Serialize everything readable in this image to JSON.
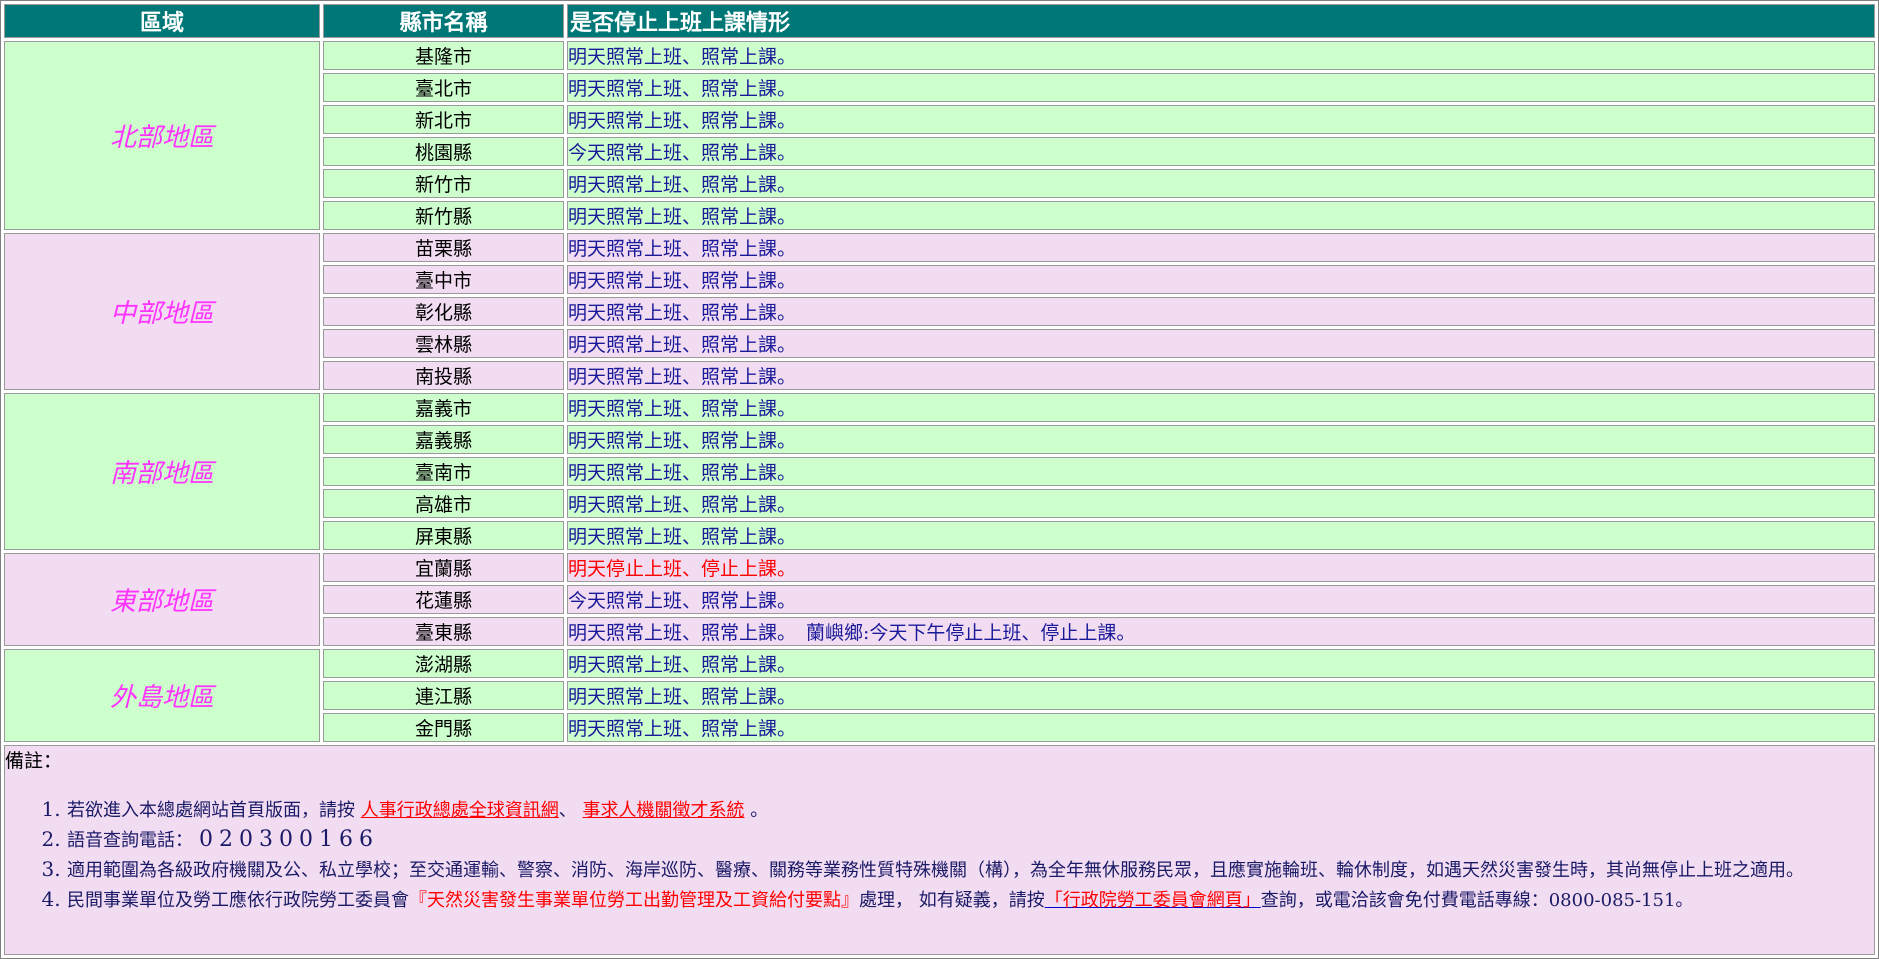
{
  "headers": {
    "region": "區域",
    "county": "縣市名稱",
    "status": "是否停止上班上課情形"
  },
  "colors": {
    "header_bg": "#007777",
    "green_row": "#ccffcc",
    "pink_row": "#f2dcf2",
    "region_text": "#ff33ff",
    "status_text": "#1a1a99",
    "alert_text": "#ff0000"
  },
  "regions": [
    {
      "name": "北部地區",
      "rows": [
        {
          "county": "基隆市",
          "status": "明天照常上班、照常上課。"
        },
        {
          "county": "臺北市",
          "status": "明天照常上班、照常上課。"
        },
        {
          "county": "新北市",
          "status": "明天照常上班、照常上課。"
        },
        {
          "county": "桃園縣",
          "status": "今天照常上班、照常上課。"
        },
        {
          "county": "新竹市",
          "status": "明天照常上班、照常上課。"
        },
        {
          "county": "新竹縣",
          "status": "明天照常上班、照常上課。"
        }
      ]
    },
    {
      "name": "中部地區",
      "rows": [
        {
          "county": "苗栗縣",
          "status": "明天照常上班、照常上課。"
        },
        {
          "county": "臺中市",
          "status": "明天照常上班、照常上課。"
        },
        {
          "county": "彰化縣",
          "status": "明天照常上班、照常上課。"
        },
        {
          "county": "雲林縣",
          "status": "明天照常上班、照常上課。"
        },
        {
          "county": "南投縣",
          "status": "明天照常上班、照常上課。"
        }
      ]
    },
    {
      "name": "南部地區",
      "rows": [
        {
          "county": "嘉義市",
          "status": "明天照常上班、照常上課。"
        },
        {
          "county": "嘉義縣",
          "status": "明天照常上班、照常上課。"
        },
        {
          "county": "臺南市",
          "status": "明天照常上班、照常上課。"
        },
        {
          "county": "高雄市",
          "status": "明天照常上班、照常上課。"
        },
        {
          "county": "屏東縣",
          "status": "明天照常上班、照常上課。"
        }
      ]
    },
    {
      "name": "東部地區",
      "rows": [
        {
          "county": "宜蘭縣",
          "status": "明天停止上班、停止上課。",
          "alert": true
        },
        {
          "county": "花蓮縣",
          "status": "今天照常上班、照常上課。"
        },
        {
          "county": "臺東縣",
          "status": "明天照常上班、照常上課。",
          "extra": "蘭嶼鄉:今天下午停止上班、停止上課。"
        }
      ]
    },
    {
      "name": "外島地區",
      "rows": [
        {
          "county": "澎湖縣",
          "status": "明天照常上班、照常上課。"
        },
        {
          "county": "連江縣",
          "status": "明天照常上班、照常上課。"
        },
        {
          "county": "金門縣",
          "status": "明天照常上班、照常上課。"
        }
      ]
    }
  ],
  "notes": {
    "title": "備註：",
    "item1_pre": "若欲進入本總處網站首頁版面，請按",
    "item1_link1": "人事行政總處全球資訊網",
    "item1_sep": "、",
    "item1_link2": "事求人機關徵才系統",
    "item1_post": "。",
    "item2_label": "語音查詢電話：",
    "item2_phone": "020300166",
    "item3": "適用範圍為各級政府機關及公、私立學校；至交通運輸、警察、消防、海岸巡防、醫療、關務等業務性質特殊機關（構），為全年無休服務民眾，且應實施輪班、輪休制度，如遇天然災害發生時，其尚無停止上班之適用。",
    "item4_pre": "民間事業單位及勞工應依行政院勞工委員會",
    "item4_doc": "『天然災害發生事業單位勞工出勤管理及工資給付要點』",
    "item4_mid": "處理，  如有疑義，請按",
    "item4_link": "「行政院勞工委員會網頁」",
    "item4_post": "查詢，或電洽該會免付費電話專線：0800-085-151。"
  }
}
